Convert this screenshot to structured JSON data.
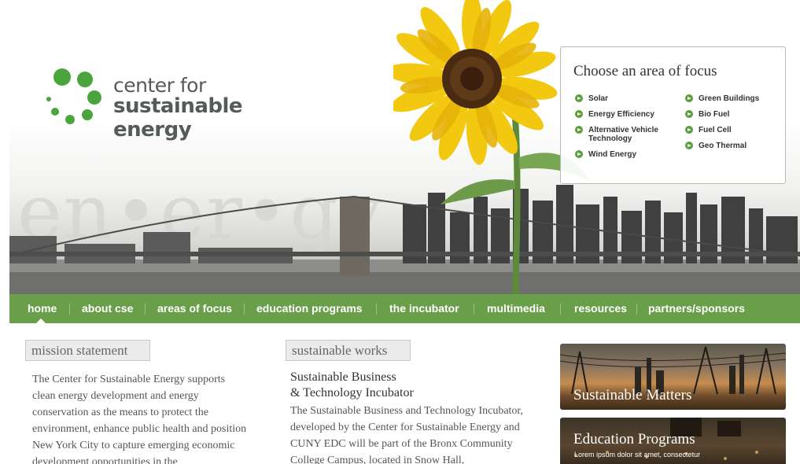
{
  "logo": {
    "line1": "center for",
    "line2": "sustainable energy"
  },
  "hero": {
    "watermark": "en•er•gy"
  },
  "focus": {
    "title": "Choose an area of focus",
    "column1": [
      "Solar",
      "Energy Efficiency",
      "Alternative Vehicle Technology",
      "Wind Energy"
    ],
    "column2": [
      "Green Buildings",
      "Bio Fuel",
      "Fuel Cell",
      "Geo Thermal"
    ]
  },
  "nav": {
    "items": [
      "home",
      "about cse",
      "areas of focus",
      "education programs",
      "the incubator",
      "multimedia",
      "resources",
      "partners/sponsors"
    ],
    "active": "home"
  },
  "mission": {
    "tab": "mission statement",
    "text": "The Center for Sustainable Energy supports clean energy development and energy conservation as the means to protect the environment, enhance public health and position New York City to capture emerging economic development opportunities in the"
  },
  "works": {
    "tab": "sustainable works",
    "heading_line1": "Sustainable Business",
    "heading_line2": "& Technology Incubator",
    "text": "The Sustainable Business and Technology Incubator, developed by the Center for Sustainable Energy and CUNY EDC will be part of the Bronx Community College Campus, located in Snow Hall,"
  },
  "promos": [
    {
      "title": "Sustainable Matters"
    },
    {
      "title": "Education Programs",
      "subtitle": "Lorem ipsum dolor sit amet, consectetur"
    }
  ],
  "colors": {
    "brand_green": "#6a9f4a",
    "logo_green": "#4aa63c",
    "arrow_green": "#5a9e3a"
  },
  "icons": {
    "focus_bullet": "arrow-right-circle-icon",
    "logo": "dots-ring-logo-icon"
  }
}
